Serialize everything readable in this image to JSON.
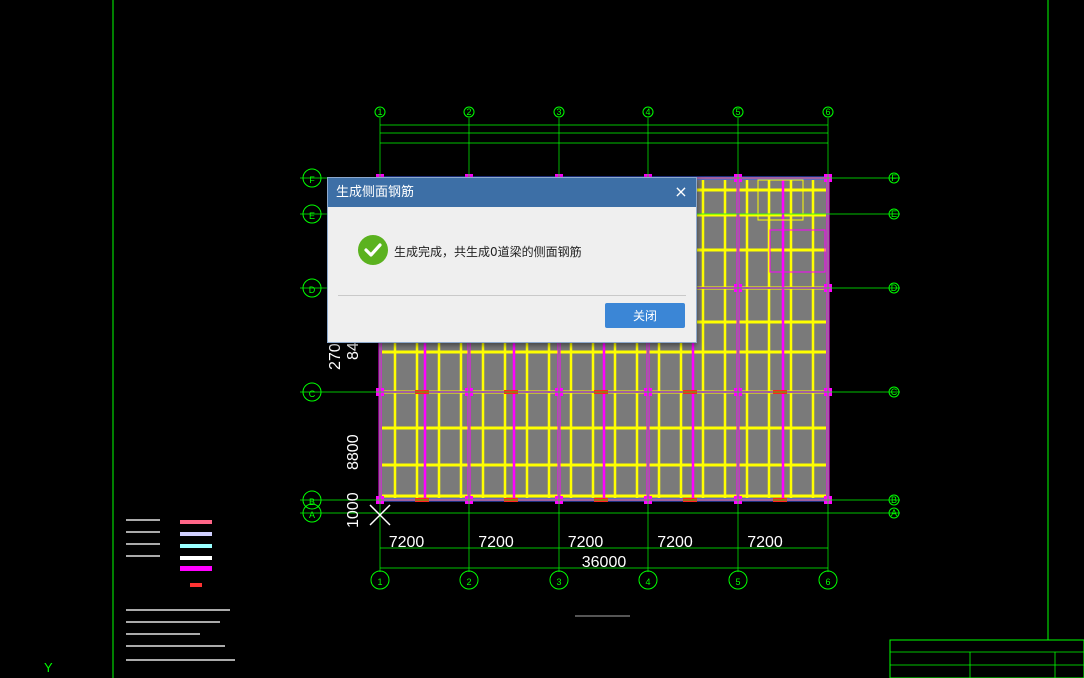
{
  "dialog": {
    "title": "生成侧面钢筋",
    "message": "生成完成，共生成0道梁的侧面钢筋",
    "close_button": "关闭",
    "close_glyph": "×"
  },
  "drawing": {
    "columns": [
      "1",
      "2",
      "3",
      "4",
      "5",
      "6"
    ],
    "rows": [
      "F",
      "E",
      "D",
      "C",
      "B",
      "A"
    ],
    "bay_dims": [
      "7200",
      "7200",
      "7200",
      "7200",
      "7200"
    ],
    "total_dim": "36000",
    "left_dims": [
      "270",
      "84",
      "8800",
      "1000"
    ],
    "ucs_label": "Y"
  },
  "colors": {
    "background": "#000000",
    "grid_line": "#00ff00",
    "beam_yellow": "#ffff00",
    "beam_magenta": "#ff00ff",
    "slab_fill": "#7a7a7a",
    "dialog_title": "#3d6fa6",
    "button": "#3b86d6",
    "success": "#5bb21f"
  }
}
